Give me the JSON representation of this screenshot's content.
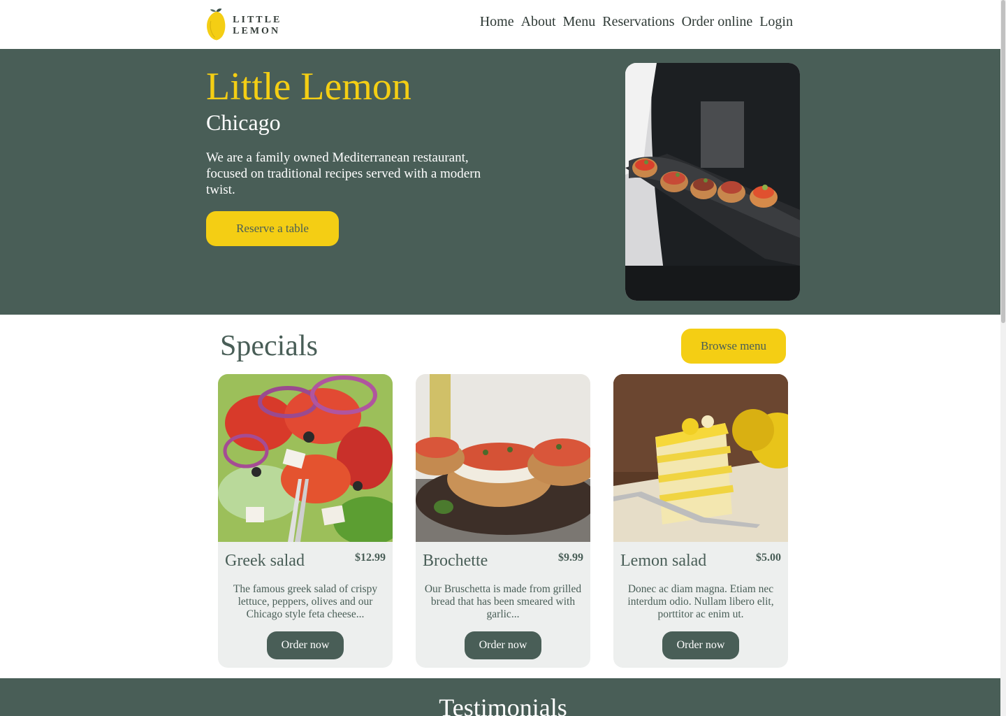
{
  "header": {
    "logo_text": "LITTLE LEMON",
    "nav": [
      "Home",
      "About",
      "Menu",
      "Reservations",
      "Order online",
      "Login"
    ]
  },
  "hero": {
    "title": "Little Lemon",
    "subtitle": "Chicago",
    "description": "We are a family owned Mediterranean restaurant, focused on traditional recipes served with a modern twist.",
    "cta_label": "Reserve a table",
    "image_icon": "waiter-serving-bruschetta-image"
  },
  "specials": {
    "title": "Specials",
    "browse_label": "Browse menu",
    "items": [
      {
        "name": "Greek salad",
        "price": "$12.99",
        "description": "The famous greek salad of crispy lettuce, peppers, olives and our Chicago style feta cheese...",
        "order_label": "Order now",
        "image_icon": "greek-salad-image"
      },
      {
        "name": "Brochette",
        "price": "$9.99",
        "description": "Our Bruschetta is made from grilled bread that has been smeared with garlic...",
        "order_label": "Order now",
        "image_icon": "bruschetta-image"
      },
      {
        "name": "Lemon salad",
        "price": "$5.00",
        "description": "Donec ac diam magna. Etiam nec interdum odio. Nullam libero elit, porttitor ac enim ut.",
        "order_label": "Order now",
        "image_icon": "lemon-cake-image"
      }
    ]
  },
  "testimonials": {
    "title": "Testimonials"
  },
  "colors": {
    "primary_green": "#495e57",
    "primary_yellow": "#f4ce14",
    "card_bg": "#edefee"
  }
}
